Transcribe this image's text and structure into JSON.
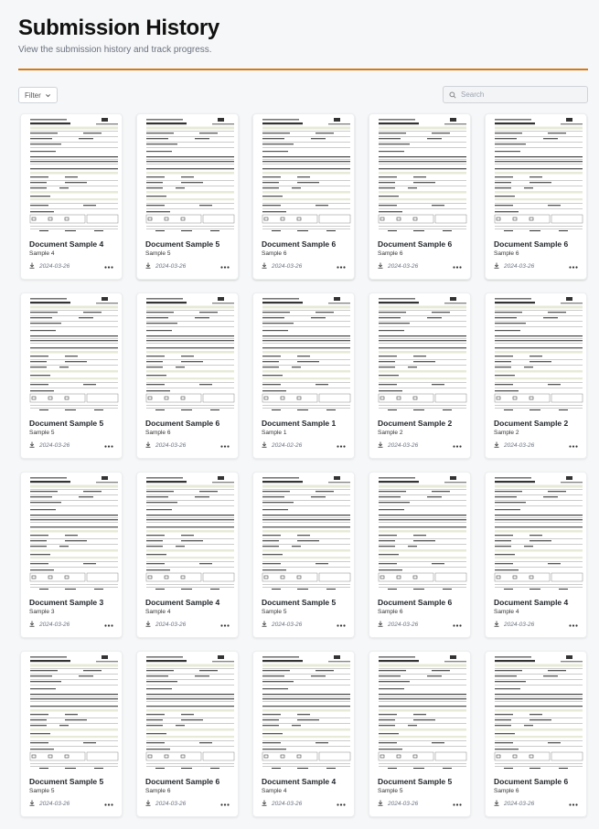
{
  "header": {
    "title": "Submission History",
    "subtitle": "View the submission history and track progress."
  },
  "toolbar": {
    "filter_label": "Filter",
    "search_placeholder": "Search"
  },
  "colors": {
    "accent": "#d67a10",
    "form_highlight": "#e7ead7"
  },
  "icons": {
    "add": "plus-square-icon",
    "download": "download-icon",
    "more": "more-dots-icon",
    "filter": "chevron-down-icon",
    "search": "search-icon"
  },
  "documents": [
    {
      "title": "Document Sample 1",
      "subtitle": "Sample 1",
      "date": "2024-02-26"
    },
    {
      "title": "Document Sample 2",
      "subtitle": "Sample 2",
      "date": "2024-03-26"
    },
    {
      "title": "Document Sample 3",
      "subtitle": "Sample 3",
      "date": "2024-03-26"
    },
    {
      "title": "Document Sample 4",
      "subtitle": "Sample 4",
      "date": "2024-03-26"
    },
    {
      "title": "Document Sample 5",
      "subtitle": "Sample 5",
      "date": "2024-03-26"
    },
    {
      "title": "Document Sample 6",
      "subtitle": "Sample 6",
      "date": "2024-03-26"
    },
    {
      "title": "Document Sample 1",
      "subtitle": "Sample 1",
      "date": "2024-02-26"
    },
    {
      "title": "Document Sample 2",
      "subtitle": "Sample 2",
      "date": "2024-03-26"
    },
    {
      "title": "Document Sample 2",
      "subtitle": "Sample 2",
      "date": "2024-03-26"
    },
    {
      "title": "Document Sample 3",
      "subtitle": "Sample 3",
      "date": "2024-03-26"
    },
    {
      "title": "Document Sample 4",
      "subtitle": "Sample 4",
      "date": "2024-03-26"
    },
    {
      "title": "Document Sample 5",
      "subtitle": "Sample 5",
      "date": "2024-03-26"
    },
    {
      "title": "Document Sample 6",
      "subtitle": "Sample 6",
      "date": "2024-03-26"
    },
    {
      "title": "Document Sample 4",
      "subtitle": "Sample 4",
      "date": "2024-03-26"
    },
    {
      "title": "Document Sample 5",
      "subtitle": "Sample 5",
      "date": "2024-03-26"
    },
    {
      "title": "Document Sample 6",
      "subtitle": "Sample 6",
      "date": "2024-03-26"
    },
    {
      "title": "Document Sample 4",
      "subtitle": "Sample 4",
      "date": "2024-03-26"
    },
    {
      "title": "Document Sample 5",
      "subtitle": "Sample 5",
      "date": "2024-03-26"
    },
    {
      "title": "Document Sample 6",
      "subtitle": "Sample 6",
      "date": "2024-03-26"
    },
    {
      "title": "Document Sample 4",
      "subtitle": "Sample 4",
      "date": "2024-03-26"
    },
    {
      "title": "Document Sample 5",
      "subtitle": "Sample 5",
      "date": "2024-03-26"
    },
    {
      "title": "Document Sample 6",
      "subtitle": "Sample 6",
      "date": "2024-03-26"
    },
    {
      "title": "Document Sample 6",
      "subtitle": "Sample 6",
      "date": "2024-03-26"
    },
    {
      "title": "Document Sample 6",
      "subtitle": "Sample 6",
      "date": "2024-03-26"
    }
  ]
}
